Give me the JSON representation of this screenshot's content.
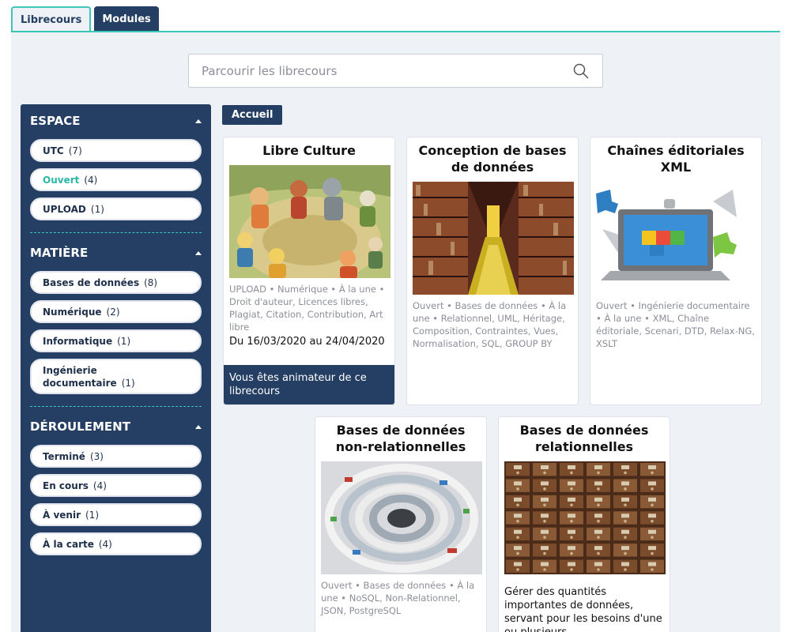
{
  "tabs": [
    {
      "label": "Librecours",
      "active": true
    },
    {
      "label": "Modules",
      "active": false
    }
  ],
  "search": {
    "placeholder": "Parcourir les librecours"
  },
  "sidebar": {
    "facets": [
      {
        "title": "ESPACE",
        "items": [
          {
            "label": "UTC",
            "count": "(7)"
          },
          {
            "label": "Ouvert",
            "count": "(4)",
            "selected": true
          },
          {
            "label": "UPLOAD",
            "count": "(1)"
          }
        ]
      },
      {
        "title": "MATIÈRE",
        "items": [
          {
            "label": "Bases de données",
            "count": "(8)"
          },
          {
            "label": "Numérique",
            "count": "(2)"
          },
          {
            "label": "Informatique",
            "count": "(1)"
          },
          {
            "label": "Ingénierie documentaire",
            "count": "(1)"
          }
        ]
      },
      {
        "title": "DÉROULEMENT",
        "items": [
          {
            "label": "Terminé",
            "count": "(3)"
          },
          {
            "label": "En cours",
            "count": "(4)"
          },
          {
            "label": "À venir",
            "count": "(1)"
          },
          {
            "label": "À la carte",
            "count": "(4)"
          }
        ]
      }
    ]
  },
  "breadcrumb": {
    "label": "Accueil"
  },
  "cards": [
    {
      "title": "Libre Culture",
      "tags": "UPLOAD • Numérique • À la une • Droit d'auteur, Licences libres, Plagiat, Citation, Contribution, Art libre",
      "date": "Du 16/03/2020 au 24/04/2020",
      "footer": "Vous êtes animateur de ce librecours"
    },
    {
      "title": "Conception de bases de données",
      "tags": "Ouvert • Bases de données • À la une • Relationnel, UML, Héritage, Composition, Contraintes, Vues, Normalisation, SQL, GROUP BY"
    },
    {
      "title": "Chaînes éditoriales XML",
      "tags": "Ouvert • Ingénierie documentaire • À la une • XML, Chaîne éditoriale, Scenari, DTD, Relax-NG, XSLT"
    },
    {
      "title": "Bases de données non-relationnelles",
      "tags": "Ouvert • Bases de données • À la une • NoSQL, Non-Relationnel, JSON, PostgreSQL"
    },
    {
      "title": "Bases de données relationnelles",
      "desc": "Gérer des quantités importantes de données, servant pour les besoins d'une ou plusieurs"
    }
  ],
  "colors": {
    "navy": "#243f63",
    "teal": "#3cc8b7",
    "panel": "#eef2f7"
  }
}
